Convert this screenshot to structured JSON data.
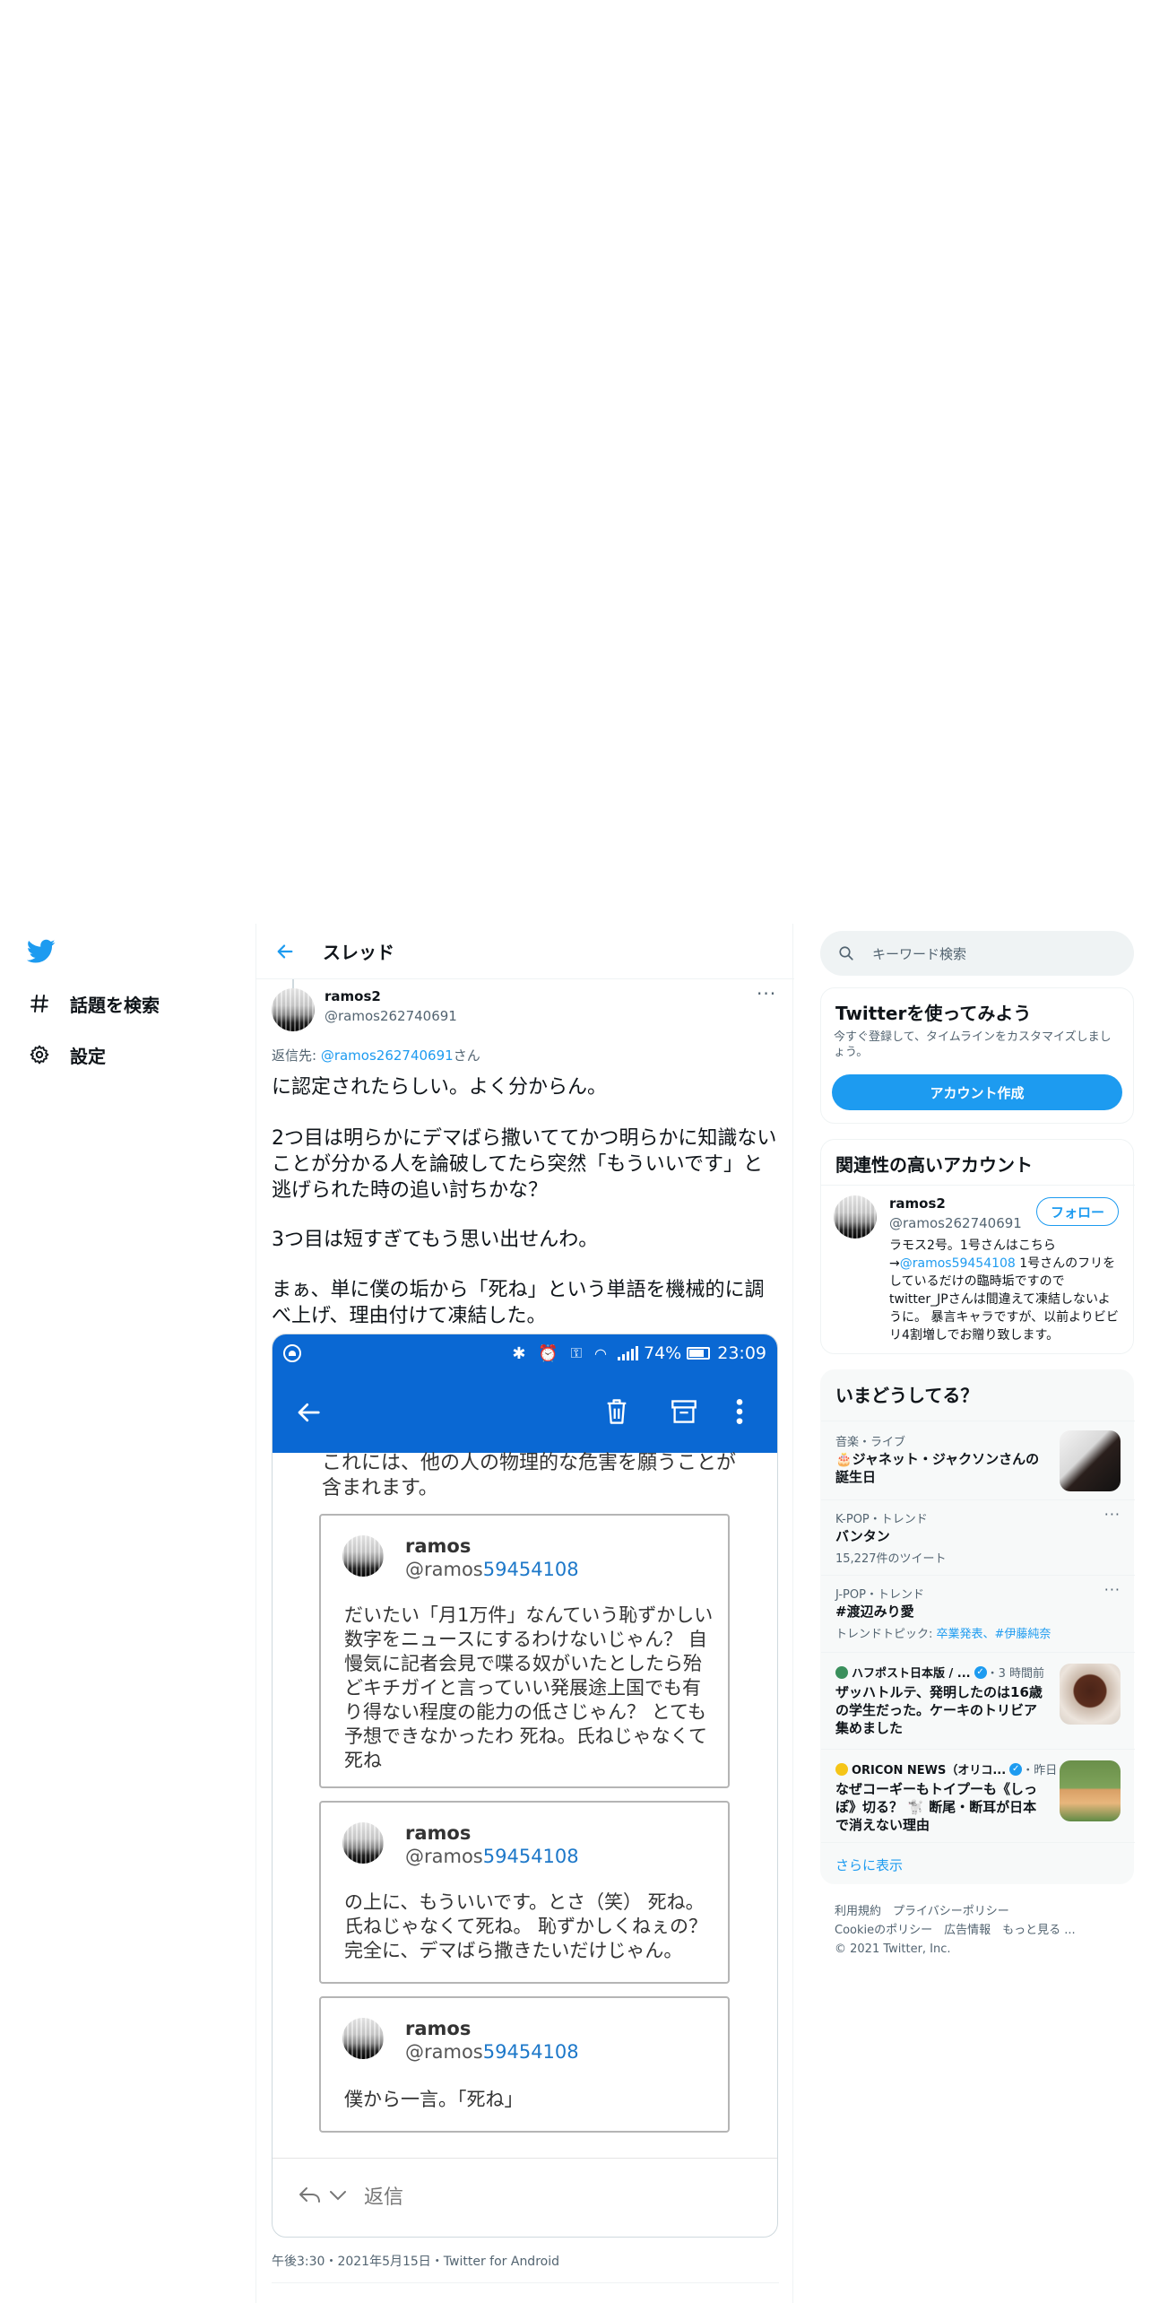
{
  "nav": {
    "items": [
      {
        "label": "話題を検索",
        "icon": "hashtag-icon"
      },
      {
        "label": "設定",
        "icon": "gear-icon"
      }
    ]
  },
  "header": {
    "title": "スレッド"
  },
  "tweet": {
    "author_name": "ramos2",
    "author_handle": "@ramos262740691",
    "reply_prefix": "返信先: ",
    "reply_handle": "@ramos262740691",
    "reply_suffix": "さん",
    "paragraphs": [
      "に認定されたらしい。よく分からん。",
      "2つ目は明らかにデマばら撒いててかつ明らかに知識ないことが分かる人を論破してたら突然「もういいです」と逃げられた時の追い討ちかな？",
      "3つ目は短すぎてもう思い出せんわ。",
      "まぁ、単に僕の垢から「死ね」という単語を機械的に調べ上げ、理由付けて凍結した。"
    ],
    "timestamp": "午後3:30・2021年5月15日・Twitter for Android"
  },
  "screenshot": {
    "battery": "74%",
    "time": "23:09",
    "notice": "これには、他の人の物理的な危害を願うことが含まれます。",
    "cards": [
      {
        "name": "ramos",
        "handle_prefix": "@ramos",
        "handle_suffix": "59454108",
        "body": "だいたい「月1万件」なんていう恥ずかしい数字をニュースにするわけないじゃん？ 自慢気に記者会見で喋る奴がいたとしたら殆どキチガイと言っていい発展途上国でも有り得ない程度の能力の低さじゃん？ とても予想できなかったわ 死ね。氏ねじゃなくて死ね"
      },
      {
        "name": "ramos",
        "handle_prefix": "@ramos",
        "handle_suffix": "59454108",
        "body": "の上に、もういいです。とさ（笑） 死ね。氏ねじゃなくて死ね。 恥ずかしくねぇの？ 完全に、デマばら撒きたいだけじゃん。"
      },
      {
        "name": "ramos",
        "handle_prefix": "@ramos",
        "handle_suffix": "59454108",
        "body": "僕から一言。「死ね」"
      }
    ],
    "reply_label": "返信"
  },
  "right": {
    "search_placeholder": "キーワード検索",
    "signup": {
      "title": "Twitterを使ってみよう",
      "desc": "今すぐ登録して、タイムラインをカスタマイズしましょう。",
      "button": "アカウント作成"
    },
    "related": {
      "title": "関連性の高いアカウント",
      "name": "ramos2",
      "handle": "@ramos262740691",
      "follow": "フォロー",
      "bio_1": "ラモス2号。1号さんはこちら→",
      "bio_link": "@ramos59454108",
      "bio_2": " 1号さんのフリをしているだけの臨時垢ですのでtwitter_JPさんは間違えて凍結しないように。 暴言キャラですが、以前よりビビリ4割増しでお贈り致します。"
    },
    "trends": {
      "title": "いまどうしてる？",
      "items": [
        {
          "meta": "音楽・ライブ",
          "name": "🎂ジャネット・ジャクソンさんの誕生日"
        },
        {
          "meta": "K-POP・トレンド",
          "name": "バンタン",
          "sub": "15,227件のツイート"
        },
        {
          "meta": "J-POP・トレンド",
          "name": "#渡辺みり愛",
          "sub_prefix": "トレンドトピック: ",
          "sub_links": "卒業発表、#伊藤純奈"
        },
        {
          "source": "ハフポスト日本版 / ...",
          "when": "・3 時間前",
          "name": "ザッハトルテ、発明したのは16歳の学生だった。ケーキのトリビア集めました"
        },
        {
          "source": "ORICON NEWS（オリコ...",
          "when": "・昨日",
          "name": "なぜコーギーもトイプーも《しっぽ》切る？ 🐩 断尾・断耳が日本で消えない理由"
        }
      ],
      "more": "さらに表示"
    },
    "footer": {
      "line1": "利用規約　プライバシーポリシー",
      "line2": "Cookieのポリシー　広告情報　もっと見る ...",
      "line3": "© 2021 Twitter, Inc."
    }
  },
  "colors": {
    "accent": "#1d9bf0",
    "app_blue": "#0a68d3"
  }
}
